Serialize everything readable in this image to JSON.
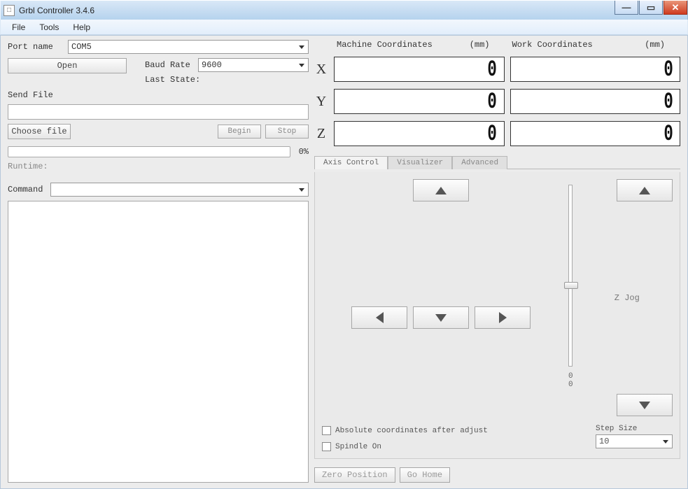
{
  "window": {
    "title": "Grbl Controller 3.4.6",
    "icon_glyph": "□"
  },
  "menu": {
    "file": "File",
    "tools": "Tools",
    "help": "Help"
  },
  "left": {
    "port_label": "Port name",
    "port_value": "COM5",
    "open_btn": "Open",
    "baud_label": "Baud Rate",
    "baud_value": "9600",
    "last_state_label": "Last State:",
    "last_state_value": "",
    "send_file_label": "Send File",
    "file_value": "",
    "choose_file_btn": "Choose file",
    "begin_btn": "Begin",
    "stop_btn": "Stop",
    "progress_pct": "0%",
    "runtime_label": "Runtime:",
    "runtime_value": "",
    "command_label": "Command",
    "command_value": ""
  },
  "coords": {
    "machine_label": "Machine Coordinates",
    "work_label": "Work Coordinates",
    "unit": "(mm)",
    "axes": [
      "X",
      "Y",
      "Z"
    ],
    "machine": {
      "X": "0",
      "Y": "0",
      "Z": "0"
    },
    "work": {
      "X": "0",
      "Y": "0",
      "Z": "0"
    }
  },
  "tabs": {
    "axis": "Axis Control",
    "visualizer": "Visualizer",
    "advanced": "Advanced",
    "active": "axis"
  },
  "jog": {
    "z_label": "Z Jog",
    "slider_top": "0",
    "slider_bottom": "0",
    "abs_coord_label": "Absolute coordinates after adjust",
    "spindle_label": "Spindle On",
    "step_size_label": "Step Size",
    "step_size_value": "10"
  },
  "footer": {
    "zero_btn": "Zero Position",
    "home_btn": "Go Home"
  }
}
